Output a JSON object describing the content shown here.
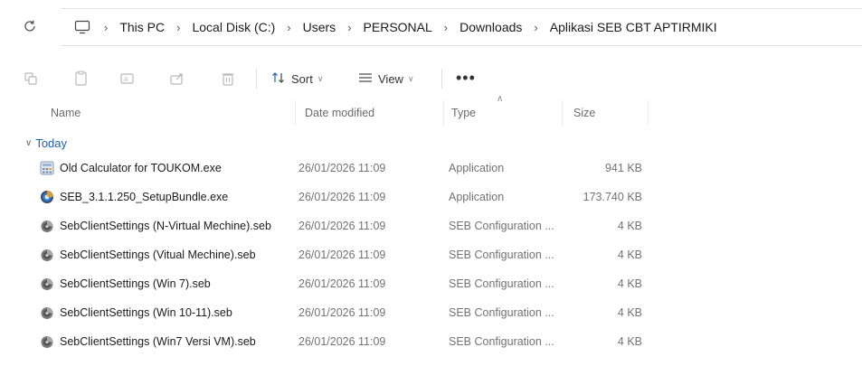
{
  "address": {
    "refresh_icon": "refresh-icon",
    "pc_icon": "computer-icon",
    "breadcrumbs": [
      "This PC",
      "Local Disk (C:)",
      "Users",
      "PERSONAL",
      "Downloads",
      "Aplikasi SEB CBT APTIRMIKI"
    ]
  },
  "toolbar": {
    "icons": [
      "cut-icon",
      "copy-icon",
      "rename-icon",
      "share-icon",
      "delete-icon"
    ],
    "sort_label": "Sort",
    "view_label": "View",
    "more_label": "•••"
  },
  "columns": {
    "name": "Name",
    "date": "Date modified",
    "type": "Type",
    "size": "Size"
  },
  "group": {
    "label": "Today"
  },
  "files": [
    {
      "icon": "calculator-app-icon",
      "name": "Old Calculator for TOUKOM.exe",
      "date": "26/01/2026 11:09",
      "type": "Application",
      "size": "941 KB"
    },
    {
      "icon": "seb-installer-icon",
      "name": "SEB_3.1.1.250_SetupBundle.exe",
      "date": "26/01/2026 11:09",
      "type": "Application",
      "size": "173.740 KB"
    },
    {
      "icon": "seb-config-icon",
      "name": "SebClientSettings (N-Virtual Mechine).seb",
      "date": "26/01/2026 11:09",
      "type": "SEB Configuration ...",
      "size": "4 KB"
    },
    {
      "icon": "seb-config-icon",
      "name": "SebClientSettings (Vitual Mechine).seb",
      "date": "26/01/2026 11:09",
      "type": "SEB Configuration ...",
      "size": "4 KB"
    },
    {
      "icon": "seb-config-icon",
      "name": "SebClientSettings (Win 7).seb",
      "date": "26/01/2026 11:09",
      "type": "SEB Configuration ...",
      "size": "4 KB"
    },
    {
      "icon": "seb-config-icon",
      "name": "SebClientSettings (Win 10-11).seb",
      "date": "26/01/2026 11:09",
      "type": "SEB Configuration ...",
      "size": "4 KB"
    },
    {
      "icon": "seb-config-icon",
      "name": "SebClientSettings (Win7 Versi VM).seb",
      "date": "26/01/2026 11:09",
      "type": "SEB Configuration ...",
      "size": "4 KB"
    }
  ]
}
